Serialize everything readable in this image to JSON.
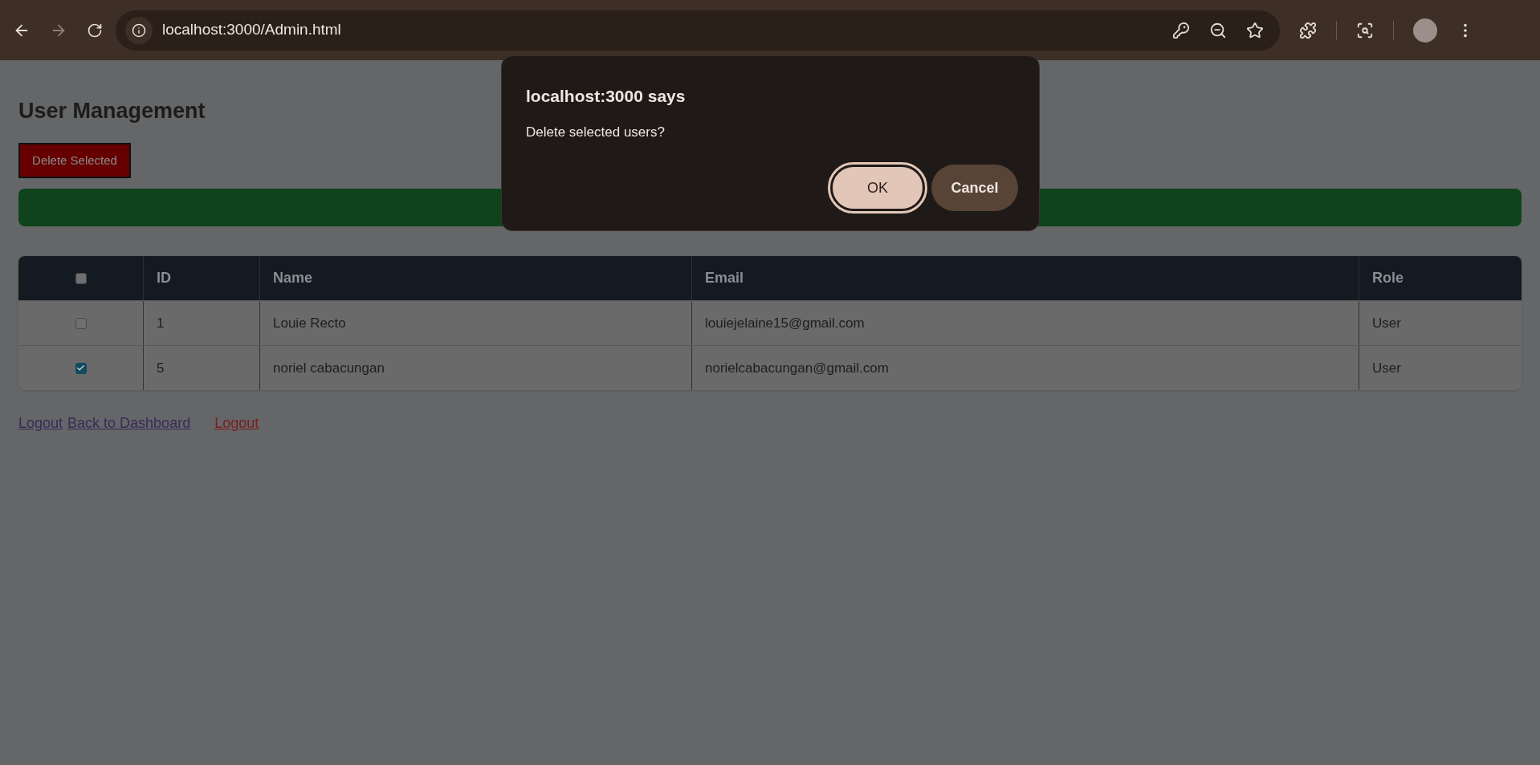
{
  "browser": {
    "url": "localhost:3000/Admin.html",
    "back_enabled": true,
    "forward_enabled": false
  },
  "page": {
    "title": "User Management",
    "delete_button": "Delete Selected",
    "table": {
      "header_checked": false,
      "columns": [
        "ID",
        "Name",
        "Email",
        "Role"
      ],
      "rows": [
        {
          "checked": false,
          "cells": [
            "1",
            "Louie Recto",
            "louiejelaine15@gmail.com",
            "User"
          ]
        },
        {
          "checked": true,
          "cells": [
            "5",
            "noriel cabacungan",
            "norielcabacungan@gmail.com",
            "User"
          ]
        }
      ]
    },
    "links": [
      {
        "label": "Logout",
        "color": "#3a2a5c"
      },
      {
        "label": "Back to Dashboard",
        "color": "#3a2a5c"
      },
      {
        "label": "Logout",
        "color": "#7a1d1d"
      }
    ]
  },
  "dialog": {
    "title": "localhost:3000 says",
    "message": "Delete selected users?",
    "buttons": [
      {
        "label": "OK",
        "kind": "primary"
      },
      {
        "label": "Cancel",
        "kind": "secondary"
      }
    ]
  }
}
